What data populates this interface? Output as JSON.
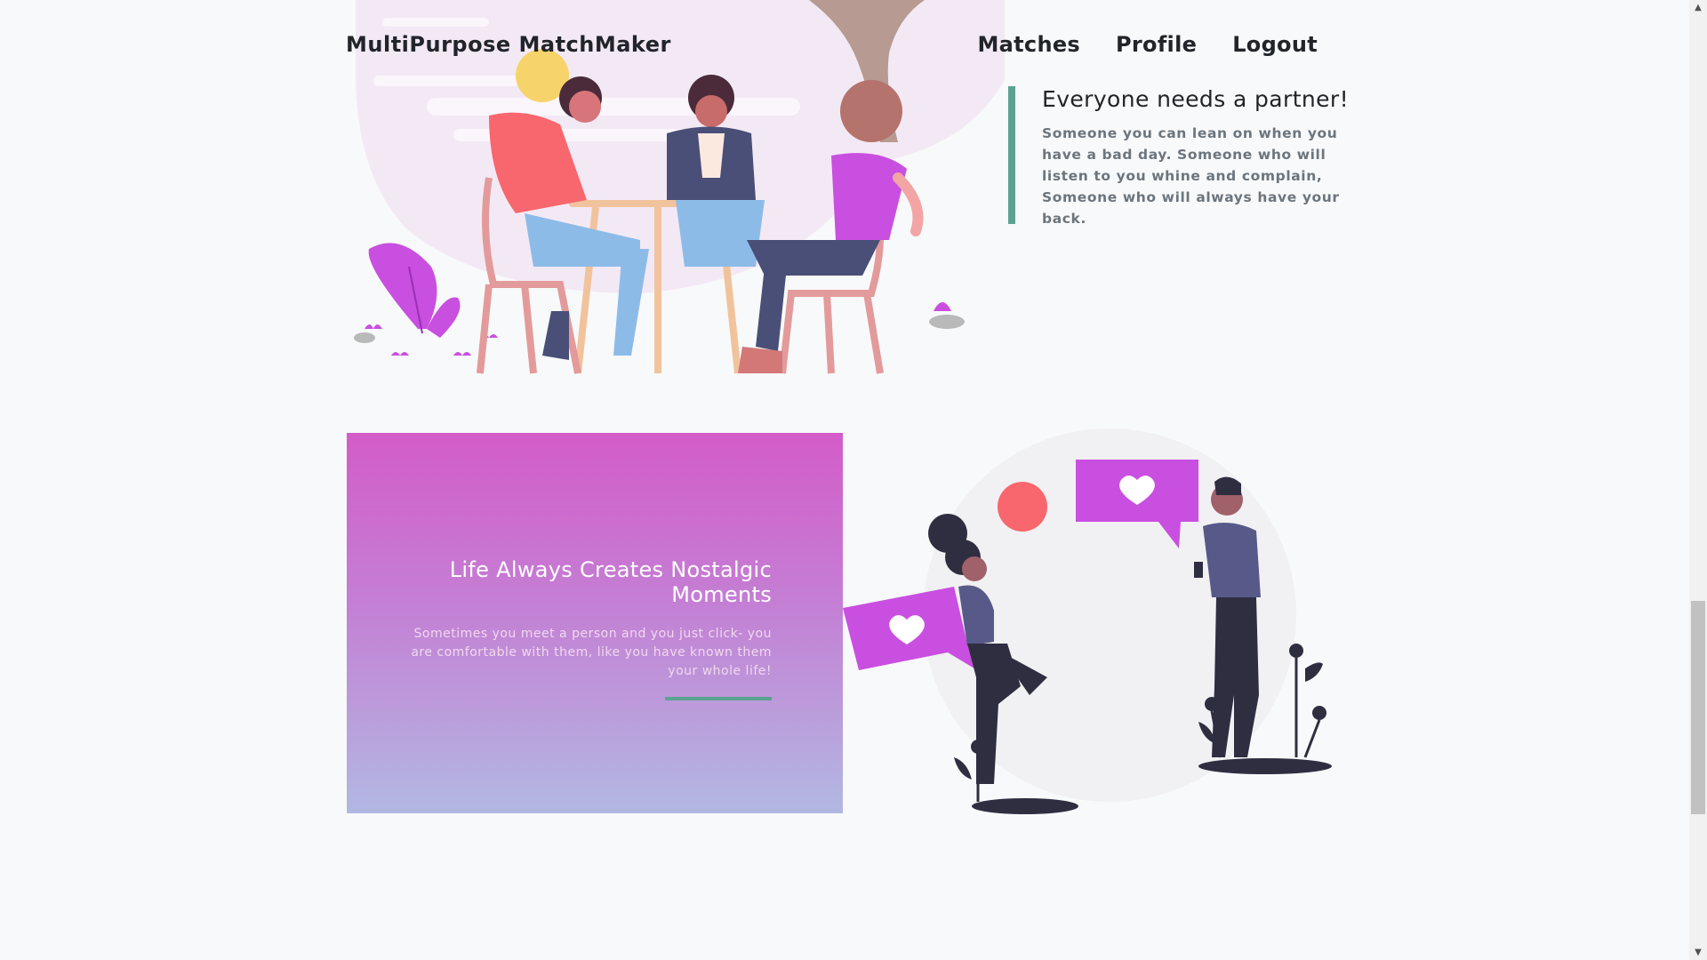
{
  "navbar": {
    "brand": "MultiPurpose MatchMaker",
    "links": [
      "Matches",
      "Profile",
      "Logout"
    ]
  },
  "quote": {
    "title": "Everyone needs a partner!",
    "body": "Someone you can lean on when you have a bad day. Someone who will listen to you whine and complain, Someone who will always have your back."
  },
  "card": {
    "title": "Life Always Creates Nostalgic Moments",
    "text": "Sometimes you meet a person and you just click- you are comfortable with them, like you have known them your whole life!"
  },
  "colors": {
    "accent": "#5aa392",
    "card_gradient_top": "#d35cc9",
    "card_gradient_bottom": "#b2b8e2",
    "illustration_purple": "#c94fe0",
    "illustration_coral": "#f8676d"
  }
}
